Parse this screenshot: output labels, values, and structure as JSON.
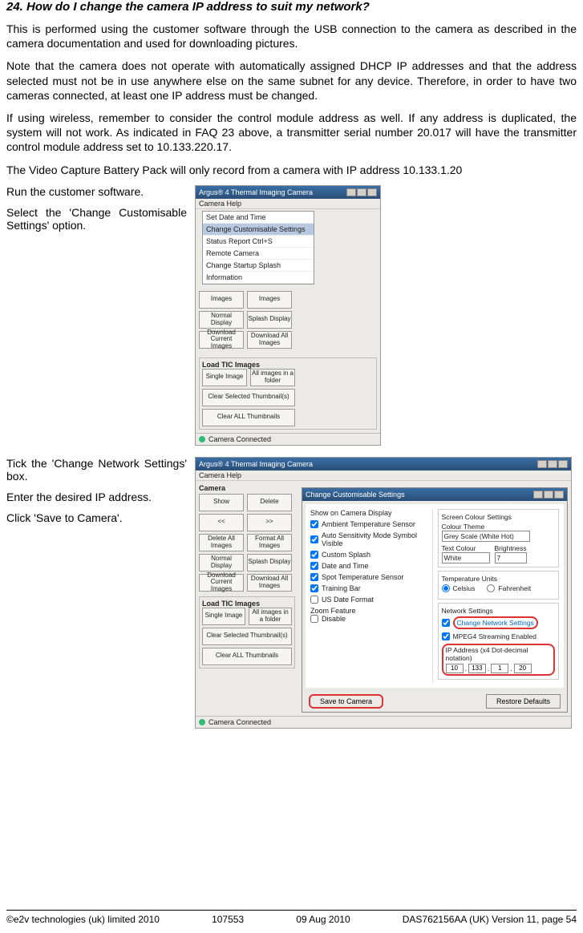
{
  "heading": "24. How do I change the camera IP address to suit my network?",
  "p1": "This is performed using the customer software through the USB connection to the camera as described in the camera documentation and used for downloading pictures.",
  "p2": "Note that the camera does not operate with automatically assigned DHCP IP addresses and that the address selected must not be in use anywhere else on the same subnet for any device. Therefore, in order to have two cameras connected, at least one IP address must be changed.",
  "p3": "If using wireless, remember to consider the control module address as well. If any address is duplicated, the system will not work. As indicated in FAQ 23 above, a transmitter serial number 20.017 will have the transmitter control module address set to 10.133.220.17.",
  "p4": "The Video Capture Battery Pack will only record from a camera with IP address 10.133.1.20",
  "step1a": "Run the customer software.",
  "step1b": "Select the 'Change Customisable Settings' option.",
  "step2a": "Tick the 'Change Network Settings' box.",
  "step2b": "Enter the desired IP address.",
  "step2c": "Click 'Save to Camera'.",
  "win": {
    "title": "Argus® 4 Thermal Imaging Camera",
    "menu": "Camera   Help",
    "menu_items": [
      "Set Date and Time",
      "Change Customisable Settings",
      "Status Report                        Ctrl+S",
      "Remote Camera",
      "Change Startup Splash",
      "Information"
    ],
    "sidebar_label": "Camera",
    "btns": {
      "show": "Show",
      "delete": "Delete",
      "back": "<<",
      "fwd": ">>",
      "delall": "Delete All Images",
      "fmtall": "Format All Images",
      "normal": "Normal Display",
      "splash": "Splash Display",
      "dlcur": "Download Current Images",
      "dlall": "Download All Images",
      "images": "Images",
      "images2": "Images"
    },
    "load_group": "Load TIC Images",
    "single": "Single Image",
    "allfolder": "All images in a folder",
    "clearsel": "Clear Selected Thumbnail(s)",
    "clearall": "Clear ALL Thumbnails",
    "status": "Camera Connected"
  },
  "dlg": {
    "title": "Change Customisable Settings",
    "left_head": "Show on Camera Display",
    "chk1": "Ambient Temperature Sensor",
    "chk2": "Auto Sensitivity Mode Symbol Visible",
    "chk3": "Custom Splash",
    "chk4": "Date and Time",
    "chk5": "Spot Temperature Sensor",
    "chk6": "Training Bar",
    "chk7": "US Date Format",
    "zoom_head": "Zoom Feature",
    "zoom_chk": "Disable",
    "scs_head": "Screen Colour Settings",
    "ctheme": "Colour Theme",
    "ctheme_val": "Grey Scale (White Hot)",
    "txtcol": "Text Colour",
    "txtcol_val": "White",
    "bright": "Brightness",
    "bright_val": "7",
    "temp_head": "Temperature Units",
    "cels": "Celsius",
    "fahr": "Fahrenheit",
    "net_head": "Network Settings",
    "net_chk": "Change Network Settings",
    "mpeg": "MPEG4 Streaming Enabled",
    "ip_lbl": "IP Address (x4 Dot-decimal notation)",
    "ip": [
      "10",
      "133",
      "1",
      "20"
    ],
    "save": "Save to Camera",
    "restore": "Restore Defaults"
  },
  "footer": {
    "copy": "©e2v technologies (uk) limited 2010",
    "num": "107553",
    "date": "09 Aug 2010",
    "ver": "DAS762156AA (UK) Version 11, page 54"
  }
}
